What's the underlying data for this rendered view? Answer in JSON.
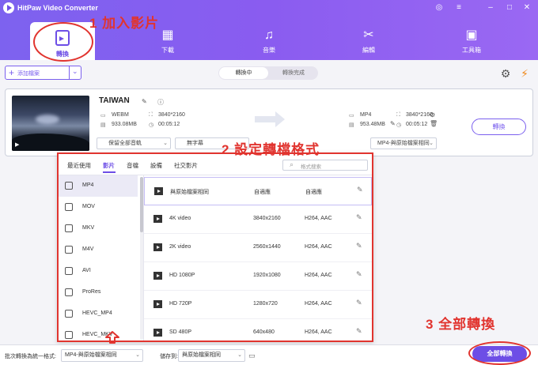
{
  "app": {
    "title": "HitPaw Video Converter"
  },
  "nav": {
    "active": {
      "label": "轉換"
    },
    "items": [
      {
        "label": "下載",
        "icon": "film-download-icon"
      },
      {
        "label": "音樂",
        "icon": "music-note-icon"
      },
      {
        "label": "編輯",
        "icon": "edit-scissors-icon"
      },
      {
        "label": "工具箱",
        "icon": "toolbox-icon"
      }
    ]
  },
  "toolbar": {
    "add_files": "添加檔案",
    "seg_converting": "轉換中",
    "seg_done": "轉換完成"
  },
  "file": {
    "name": "TAIWAN",
    "source": {
      "format": "WEBM",
      "resolution": "3840*2160",
      "size": "933.08MB",
      "duration": "00:05:12"
    },
    "target": {
      "format": "MP4",
      "resolution": "3840*2160",
      "size": "953.48MB",
      "duration": "00:05:12"
    },
    "audio_option": "保留全部音軌",
    "subtitle_option": "無字幕",
    "format_option": "MP4-與原始檔案相同",
    "convert_label": "轉換"
  },
  "popup": {
    "tabs": [
      "最近使用",
      "影片",
      "音檔",
      "設備",
      "社交影片"
    ],
    "search_placeholder": "格式搜索",
    "formats": [
      "MP4",
      "MOV",
      "MKV",
      "M4V",
      "AVI",
      "ProRes",
      "HEVC_MP4",
      "HEVC_MKV"
    ],
    "presets": [
      {
        "name": "與原始檔案相同",
        "resolution": "自適應",
        "codec": "自適應"
      },
      {
        "name": "4K video",
        "resolution": "3840x2160",
        "codec": "H264, AAC"
      },
      {
        "name": "2K video",
        "resolution": "2560x1440",
        "codec": "H264, AAC"
      },
      {
        "name": "HD 1080P",
        "resolution": "1920x1080",
        "codec": "H264, AAC"
      },
      {
        "name": "HD 720P",
        "resolution": "1280x720",
        "codec": "H264, AAC"
      },
      {
        "name": "SD 480P",
        "resolution": "640x480",
        "codec": "H264, AAC"
      }
    ]
  },
  "bottom": {
    "batch_label": "批次轉換為統一格式:",
    "batch_value": "MP4-與原始檔案相同",
    "save_label": "儲存到:",
    "save_value": "與原始檔案相同",
    "convert_all": "全部轉換"
  },
  "annotations": {
    "step1": "1 加入影片",
    "step2": "2 設定轉檔格式",
    "step3": "3 全部轉換"
  },
  "colors": {
    "accent": "#6d4ee6",
    "annotation": "#e1342f"
  }
}
